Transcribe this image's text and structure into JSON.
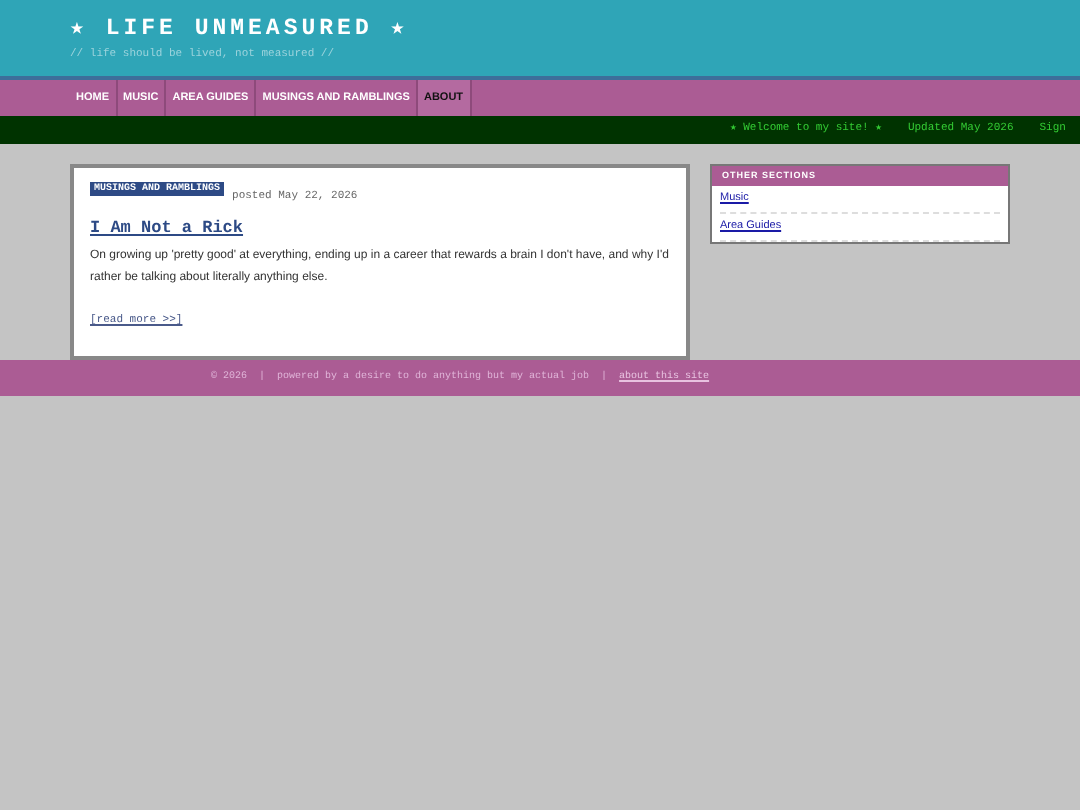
{
  "header": {
    "title": "★ LIFE UNMEASURED ★",
    "tagline": "// life should be lived, not measured //"
  },
  "nav": [
    {
      "label": "HOME",
      "selected": false
    },
    {
      "label": "MUSIC",
      "selected": false
    },
    {
      "label": "AREA GUIDES",
      "selected": false
    },
    {
      "label": "MUSINGS AND RAMBLINGS",
      "selected": false
    },
    {
      "label": "ABOUT",
      "selected": true
    }
  ],
  "ticker": [
    "★ Welcome to my site! ★",
    "Updated May 2026",
    "Sign"
  ],
  "post": {
    "category": "MUSINGS AND RAMBLINGS",
    "date": "posted May 22, 2026",
    "title": "I Am Not a Rick",
    "excerpt": "On growing up 'pretty good' at everything, ending up in a career that rewards a brain I don't have, and why I'd rather be talking about literally anything else.",
    "read_more": "[read more >>]"
  },
  "sidebar": {
    "title": "OTHER SECTIONS",
    "links": [
      "Music",
      "Area Guides"
    ]
  },
  "footer": {
    "copyright": "© 2026",
    "separator_1": "|",
    "tagline": "powered by a desire to do anything but my actual job",
    "separator_2": "|",
    "link": "about this site"
  }
}
